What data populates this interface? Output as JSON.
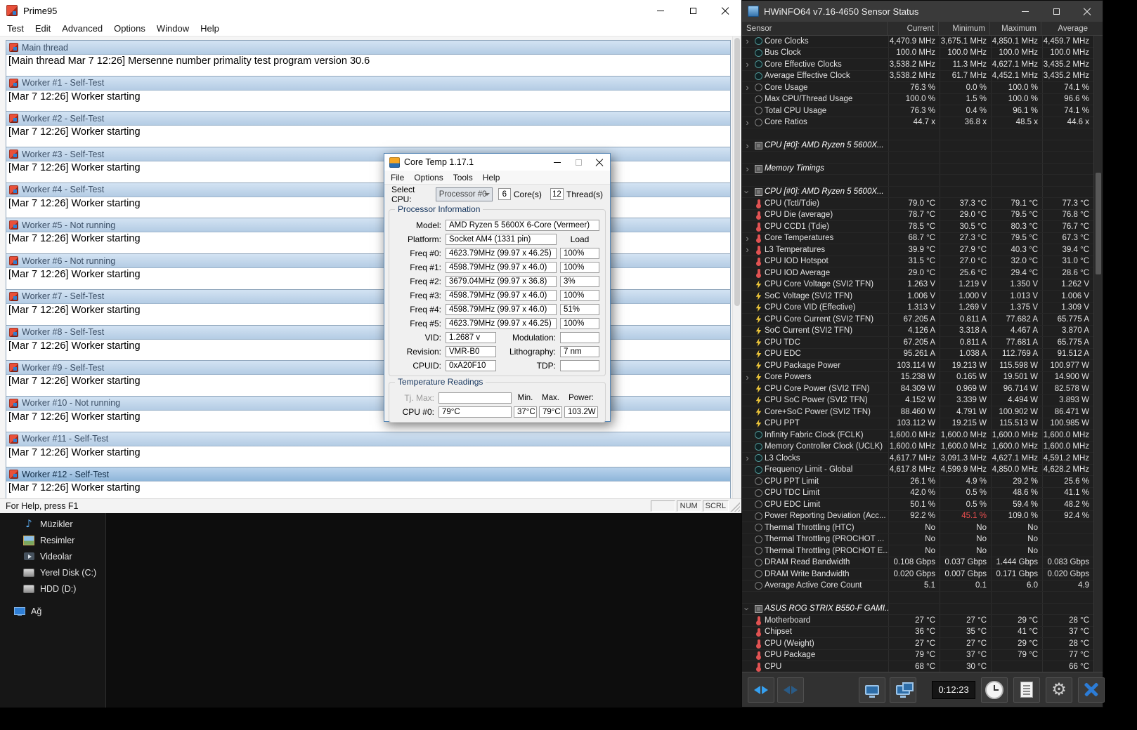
{
  "prime95": {
    "title": "Prime95",
    "menus": [
      "Test",
      "Edit",
      "Advanced",
      "Options",
      "Window",
      "Help"
    ],
    "children": [
      {
        "title": "Main thread",
        "line": "[Main thread Mar 7 12:26] Mersenne number primality test program version 30.6"
      },
      {
        "title": "Worker #1 - Self-Test",
        "line": "[Mar 7 12:26] Worker starting"
      },
      {
        "title": "Worker #2 - Self-Test",
        "line": "[Mar 7 12:26] Worker starting"
      },
      {
        "title": "Worker #3 - Self-Test",
        "line": "[Mar 7 12:26] Worker starting"
      },
      {
        "title": "Worker #4 - Self-Test",
        "line": "[Mar 7 12:26] Worker starting"
      },
      {
        "title": "Worker #5 - Not running",
        "line": "[Mar 7 12:26] Worker starting"
      },
      {
        "title": "Worker #6 - Not running",
        "line": "[Mar 7 12:26] Worker starting"
      },
      {
        "title": "Worker #7 - Self-Test",
        "line": "[Mar 7 12:26] Worker starting"
      },
      {
        "title": "Worker #8 - Self-Test",
        "line": "[Mar 7 12:26] Worker starting"
      },
      {
        "title": "Worker #9 - Self-Test",
        "line": "[Mar 7 12:26] Worker starting"
      },
      {
        "title": "Worker #10 - Not running",
        "line": "[Mar 7 12:26] Worker starting"
      },
      {
        "title": "Worker #11 - Self-Test",
        "line": "[Mar 7 12:26] Worker starting"
      },
      {
        "title": "Worker #12 - Self-Test",
        "line": "[Mar 7 12:26] Worker starting",
        "active": "1"
      }
    ],
    "status": "For Help, press F1",
    "status_boxes": [
      "",
      "NUM",
      "SCRL"
    ]
  },
  "coretemp": {
    "title": "Core Temp 1.17.1",
    "menus": [
      "File",
      "Options",
      "Tools",
      "Help"
    ],
    "select_cpu": {
      "label": "Select CPU:",
      "value": "Processor #0",
      "cores": "6",
      "cores_label": "Core(s)",
      "threads": "12",
      "threads_label": "Thread(s)"
    },
    "proc_info": {
      "title": "Processor Information",
      "model_label": "Model:",
      "model": "AMD Ryzen 5 5600X 6-Core (Vermeer)",
      "platform_label": "Platform:",
      "platform": "Socket AM4 (1331 pin)",
      "load_header": "Load",
      "freqs": [
        {
          "label": "Freq #0:",
          "value": "4623.79MHz (99.97 x 46.25)",
          "load": "100%"
        },
        {
          "label": "Freq #1:",
          "value": "4598.79MHz (99.97 x 46.0)",
          "load": "100%"
        },
        {
          "label": "Freq #2:",
          "value": "3679.04MHz (99.97 x 36.8)",
          "load": "3%"
        },
        {
          "label": "Freq #3:",
          "value": "4598.79MHz (99.97 x 46.0)",
          "load": "100%"
        },
        {
          "label": "Freq #4:",
          "value": "4598.79MHz (99.97 x 46.0)",
          "load": "51%"
        },
        {
          "label": "Freq #5:",
          "value": "4623.79MHz (99.97 x 46.25)",
          "load": "100%"
        }
      ],
      "vid_label": "VID:",
      "vid": "1.2687 v",
      "modulation_label": "Modulation:",
      "modulation": "",
      "revision_label": "Revision:",
      "revision": "VMR-B0",
      "lithography_label": "Lithography:",
      "lithography": "7 nm",
      "cpuid_label": "CPUID:",
      "cpuid": "0xA20F10",
      "tdp_label": "TDP:",
      "tdp": ""
    },
    "temps": {
      "title": "Temperature Readings",
      "tjmax_label": "Tj. Max:",
      "tjmax": "",
      "min_header": "Min.",
      "max_header": "Max.",
      "power_header": "Power:",
      "rows": [
        {
          "label": "CPU #0:",
          "value": "79°C",
          "min": "37°C",
          "max": "79°C",
          "power": "103.2W"
        }
      ]
    }
  },
  "hwinfo": {
    "title": "HWiNFO64 v7.16-4650 Sensor Status",
    "columns": [
      "Sensor",
      "Current",
      "Minimum",
      "Maximum",
      "Average"
    ],
    "accent_red": "#f05050",
    "rows": [
      {
        "t": "row",
        "c": "r",
        "i": "clock",
        "n": "Core Clocks",
        "v0": "4,470.9 MHz",
        "v1": "3,675.1 MHz",
        "v2": "4,850.1 MHz",
        "v3": "4,459.7 MHz"
      },
      {
        "t": "row",
        "c": "",
        "i": "clock",
        "n": "Bus Clock",
        "v0": "100.0 MHz",
        "v1": "100.0 MHz",
        "v2": "100.0 MHz",
        "v3": "100.0 MHz"
      },
      {
        "t": "row",
        "c": "r",
        "i": "clock",
        "n": "Core Effective Clocks",
        "v0": "3,538.2 MHz",
        "v1": "11.3 MHz",
        "v2": "4,627.1 MHz",
        "v3": "3,435.2 MHz"
      },
      {
        "t": "row",
        "c": "",
        "i": "clock",
        "n": "Average Effective Clock",
        "v0": "3,538.2 MHz",
        "v1": "61.7 MHz",
        "v2": "4,452.1 MHz",
        "v3": "3,435.2 MHz"
      },
      {
        "t": "row",
        "c": "r",
        "i": "gauge",
        "n": "Core Usage",
        "v0": "76.3 %",
        "v1": "0.0 %",
        "v2": "100.0 %",
        "v3": "74.1 %"
      },
      {
        "t": "row",
        "c": "",
        "i": "gauge",
        "n": "Max CPU/Thread Usage",
        "v0": "100.0 %",
        "v1": "1.5 %",
        "v2": "100.0 %",
        "v3": "96.6 %"
      },
      {
        "t": "row",
        "c": "",
        "i": "gauge",
        "n": "Total CPU Usage",
        "v0": "76.3 %",
        "v1": "0.4 %",
        "v2": "96.1 %",
        "v3": "74.1 %"
      },
      {
        "t": "row",
        "c": "r",
        "i": "gauge",
        "n": "Core Ratios",
        "v0": "44.7 x",
        "v1": "36.8 x",
        "v2": "48.5 x",
        "v3": "44.6 x"
      },
      {
        "t": "sp"
      },
      {
        "t": "sec",
        "c": "r",
        "i": "chip",
        "n": "CPU [#0]: AMD Ryzen 5 5600X..."
      },
      {
        "t": "sp"
      },
      {
        "t": "sec",
        "c": "r",
        "i": "chip",
        "n": "Memory Timings"
      },
      {
        "t": "sp"
      },
      {
        "t": "sec",
        "c": "d",
        "i": "chip",
        "n": "CPU [#0]: AMD Ryzen 5 5600X..."
      },
      {
        "t": "row",
        "c": "",
        "i": "thermo",
        "n": "CPU (Tctl/Tdie)",
        "v0": "79.0 °C",
        "v1": "37.3 °C",
        "v2": "79.1 °C",
        "v3": "77.3 °C"
      },
      {
        "t": "row",
        "c": "",
        "i": "thermo",
        "n": "CPU Die (average)",
        "v0": "78.7 °C",
        "v1": "29.0 °C",
        "v2": "79.5 °C",
        "v3": "76.8 °C"
      },
      {
        "t": "row",
        "c": "",
        "i": "thermo",
        "n": "CPU CCD1 (Tdie)",
        "v0": "78.5 °C",
        "v1": "30.5 °C",
        "v2": "80.3 °C",
        "v3": "76.7 °C"
      },
      {
        "t": "row",
        "c": "r",
        "i": "thermo",
        "n": "Core Temperatures",
        "v0": "68.7 °C",
        "v1": "27.3 °C",
        "v2": "79.5 °C",
        "v3": "67.3 °C"
      },
      {
        "t": "row",
        "c": "r",
        "i": "thermo",
        "n": "L3 Temperatures",
        "v0": "39.9 °C",
        "v1": "27.9 °C",
        "v2": "40.3 °C",
        "v3": "39.4 °C"
      },
      {
        "t": "row",
        "c": "",
        "i": "thermo",
        "n": "CPU IOD Hotspot",
        "v0": "31.5 °C",
        "v1": "27.0 °C",
        "v2": "32.0 °C",
        "v3": "31.0 °C"
      },
      {
        "t": "row",
        "c": "",
        "i": "thermo",
        "n": "CPU IOD Average",
        "v0": "29.0 °C",
        "v1": "25.6 °C",
        "v2": "29.4 °C",
        "v3": "28.6 °C"
      },
      {
        "t": "row",
        "c": "",
        "i": "bolt",
        "n": "CPU Core Voltage (SVI2 TFN)",
        "v0": "1.263 V",
        "v1": "1.219 V",
        "v2": "1.350 V",
        "v3": "1.262 V"
      },
      {
        "t": "row",
        "c": "",
        "i": "bolt",
        "n": "SoC Voltage (SVI2 TFN)",
        "v0": "1.006 V",
        "v1": "1.000 V",
        "v2": "1.013 V",
        "v3": "1.006 V"
      },
      {
        "t": "row",
        "c": "",
        "i": "bolt",
        "n": "CPU Core VID (Effective)",
        "v0": "1.313 V",
        "v1": "1.269 V",
        "v2": "1.375 V",
        "v3": "1.309 V"
      },
      {
        "t": "row",
        "c": "",
        "i": "bolt",
        "n": "CPU Core Current (SVI2 TFN)",
        "v0": "67.205 A",
        "v1": "0.811 A",
        "v2": "77.682 A",
        "v3": "65.775 A"
      },
      {
        "t": "row",
        "c": "",
        "i": "bolt",
        "n": "SoC Current (SVI2 TFN)",
        "v0": "4.126 A",
        "v1": "3.318 A",
        "v2": "4.467 A",
        "v3": "3.870 A"
      },
      {
        "t": "row",
        "c": "",
        "i": "bolt",
        "n": "CPU TDC",
        "v0": "67.205 A",
        "v1": "0.811 A",
        "v2": "77.681 A",
        "v3": "65.775 A"
      },
      {
        "t": "row",
        "c": "",
        "i": "bolt",
        "n": "CPU EDC",
        "v0": "95.261 A",
        "v1": "1.038 A",
        "v2": "112.769 A",
        "v3": "91.512 A"
      },
      {
        "t": "row",
        "c": "",
        "i": "bolt",
        "n": "CPU Package Power",
        "v0": "103.114 W",
        "v1": "19.213 W",
        "v2": "115.598 W",
        "v3": "100.977 W"
      },
      {
        "t": "row",
        "c": "r",
        "i": "bolt",
        "n": "Core Powers",
        "v0": "15.238 W",
        "v1": "0.165 W",
        "v2": "19.501 W",
        "v3": "14.900 W"
      },
      {
        "t": "row",
        "c": "",
        "i": "bolt",
        "n": "CPU Core Power (SVI2 TFN)",
        "v0": "84.309 W",
        "v1": "0.969 W",
        "v2": "96.714 W",
        "v3": "82.578 W"
      },
      {
        "t": "row",
        "c": "",
        "i": "bolt",
        "n": "CPU SoC Power (SVI2 TFN)",
        "v0": "4.152 W",
        "v1": "3.339 W",
        "v2": "4.494 W",
        "v3": "3.893 W"
      },
      {
        "t": "row",
        "c": "",
        "i": "bolt",
        "n": "Core+SoC Power (SVI2 TFN)",
        "v0": "88.460 W",
        "v1": "4.791 W",
        "v2": "100.902 W",
        "v3": "86.471 W"
      },
      {
        "t": "row",
        "c": "",
        "i": "bolt",
        "n": "CPU PPT",
        "v0": "103.112 W",
        "v1": "19.215 W",
        "v2": "115.513 W",
        "v3": "100.985 W"
      },
      {
        "t": "row",
        "c": "",
        "i": "clock",
        "n": "Infinity Fabric Clock (FCLK)",
        "v0": "1,600.0 MHz",
        "v1": "1,600.0 MHz",
        "v2": "1,600.0 MHz",
        "v3": "1,600.0 MHz"
      },
      {
        "t": "row",
        "c": "",
        "i": "clock",
        "n": "Memory Controller Clock (UCLK)",
        "v0": "1,600.0 MHz",
        "v1": "1,600.0 MHz",
        "v2": "1,600.0 MHz",
        "v3": "1,600.0 MHz"
      },
      {
        "t": "row",
        "c": "r",
        "i": "clock",
        "n": "L3 Clocks",
        "v0": "4,617.7 MHz",
        "v1": "3,091.3 MHz",
        "v2": "4,627.1 MHz",
        "v3": "4,591.2 MHz"
      },
      {
        "t": "row",
        "c": "",
        "i": "clock",
        "n": "Frequency Limit - Global",
        "v0": "4,617.8 MHz",
        "v1": "4,599.9 MHz",
        "v2": "4,850.0 MHz",
        "v3": "4,628.2 MHz"
      },
      {
        "t": "row",
        "c": "",
        "i": "gauge",
        "n": "CPU PPT Limit",
        "v0": "26.1 %",
        "v1": "4.9 %",
        "v2": "29.2 %",
        "v3": "25.6 %"
      },
      {
        "t": "row",
        "c": "",
        "i": "gauge",
        "n": "CPU TDC Limit",
        "v0": "42.0 %",
        "v1": "0.5 %",
        "v2": "48.6 %",
        "v3": "41.1 %"
      },
      {
        "t": "row",
        "c": "",
        "i": "gauge",
        "n": "CPU EDC Limit",
        "v0": "50.1 %",
        "v1": "0.5 %",
        "v2": "59.4 %",
        "v3": "48.2 %"
      },
      {
        "t": "row",
        "c": "",
        "i": "gauge",
        "n": "Power Reporting Deviation (Acc...",
        "v0": "92.2 %",
        "v1": "45.1 %",
        "k1": "red",
        "v2": "109.0 %",
        "v3": "92.4 %"
      },
      {
        "t": "row",
        "c": "",
        "i": "gauge",
        "n": "Thermal Throttling (HTC)",
        "v0": "No",
        "v1": "No",
        "v2": "No",
        "v3": ""
      },
      {
        "t": "row",
        "c": "",
        "i": "gauge",
        "n": "Thermal Throttling (PROCHOT ...",
        "v0": "No",
        "v1": "No",
        "v2": "No",
        "v3": ""
      },
      {
        "t": "row",
        "c": "",
        "i": "gauge",
        "n": "Thermal Throttling (PROCHOT E...",
        "v0": "No",
        "v1": "No",
        "v2": "No",
        "v3": ""
      },
      {
        "t": "row",
        "c": "",
        "i": "gauge",
        "n": "DRAM Read Bandwidth",
        "v0": "0.108 Gbps",
        "v1": "0.037 Gbps",
        "v2": "1.444 Gbps",
        "v3": "0.083 Gbps"
      },
      {
        "t": "row",
        "c": "",
        "i": "gauge",
        "n": "DRAM Write Bandwidth",
        "v0": "0.020 Gbps",
        "v1": "0.007 Gbps",
        "v2": "0.171 Gbps",
        "v3": "0.020 Gbps"
      },
      {
        "t": "row",
        "c": "",
        "i": "gauge",
        "n": "Average Active Core Count",
        "v0": "5.1",
        "v1": "0.1",
        "v2": "6.0",
        "v3": "4.9"
      },
      {
        "t": "sp"
      },
      {
        "t": "sec",
        "c": "d",
        "i": "chip",
        "n": "ASUS ROG STRIX B550-F GAMI..."
      },
      {
        "t": "row",
        "c": "",
        "i": "thermo",
        "n": "Motherboard",
        "v0": "27 °C",
        "v1": "27 °C",
        "v2": "29 °C",
        "v3": "28 °C"
      },
      {
        "t": "row",
        "c": "",
        "i": "thermo",
        "n": "Chipset",
        "v0": "36 °C",
        "v1": "35 °C",
        "v2": "41 °C",
        "v3": "37 °C"
      },
      {
        "t": "row",
        "c": "",
        "i": "thermo",
        "n": "CPU (Weight)",
        "v0": "27 °C",
        "v1": "27 °C",
        "v2": "29 °C",
        "v3": "28 °C"
      },
      {
        "t": "row",
        "c": "",
        "i": "thermo",
        "n": "CPU Package",
        "v0": "79 °C",
        "v1": "37 °C",
        "v2": "79 °C",
        "v3": "77 °C"
      },
      {
        "t": "row",
        "c": "",
        "i": "thermo",
        "n": "CPU",
        "v0": "68 °C",
        "v1": "30 °C",
        "v2": "",
        "v3": "66 °C"
      }
    ],
    "toolbar": {
      "time": "0:12:23",
      "icons": [
        "back-forward-arrows",
        "forward-arrows-dim",
        "monitor",
        "dual-monitor",
        "clock",
        "report-log",
        "settings-gear",
        "close-x"
      ]
    }
  },
  "explorer": {
    "items": [
      {
        "label": "Müzikler",
        "icon": "music",
        "cls": "sub"
      },
      {
        "label": "Resimler",
        "icon": "pictures",
        "cls": "sub"
      },
      {
        "label": "Videolar",
        "icon": "videos",
        "cls": "sub"
      },
      {
        "label": "Yerel Disk (C:)",
        "icon": "drive",
        "cls": "sub"
      },
      {
        "label": "HDD (D:)",
        "icon": "drive",
        "cls": "sub"
      },
      {
        "label": "Ağ",
        "icon": "network",
        "cls": "root gap"
      }
    ]
  }
}
